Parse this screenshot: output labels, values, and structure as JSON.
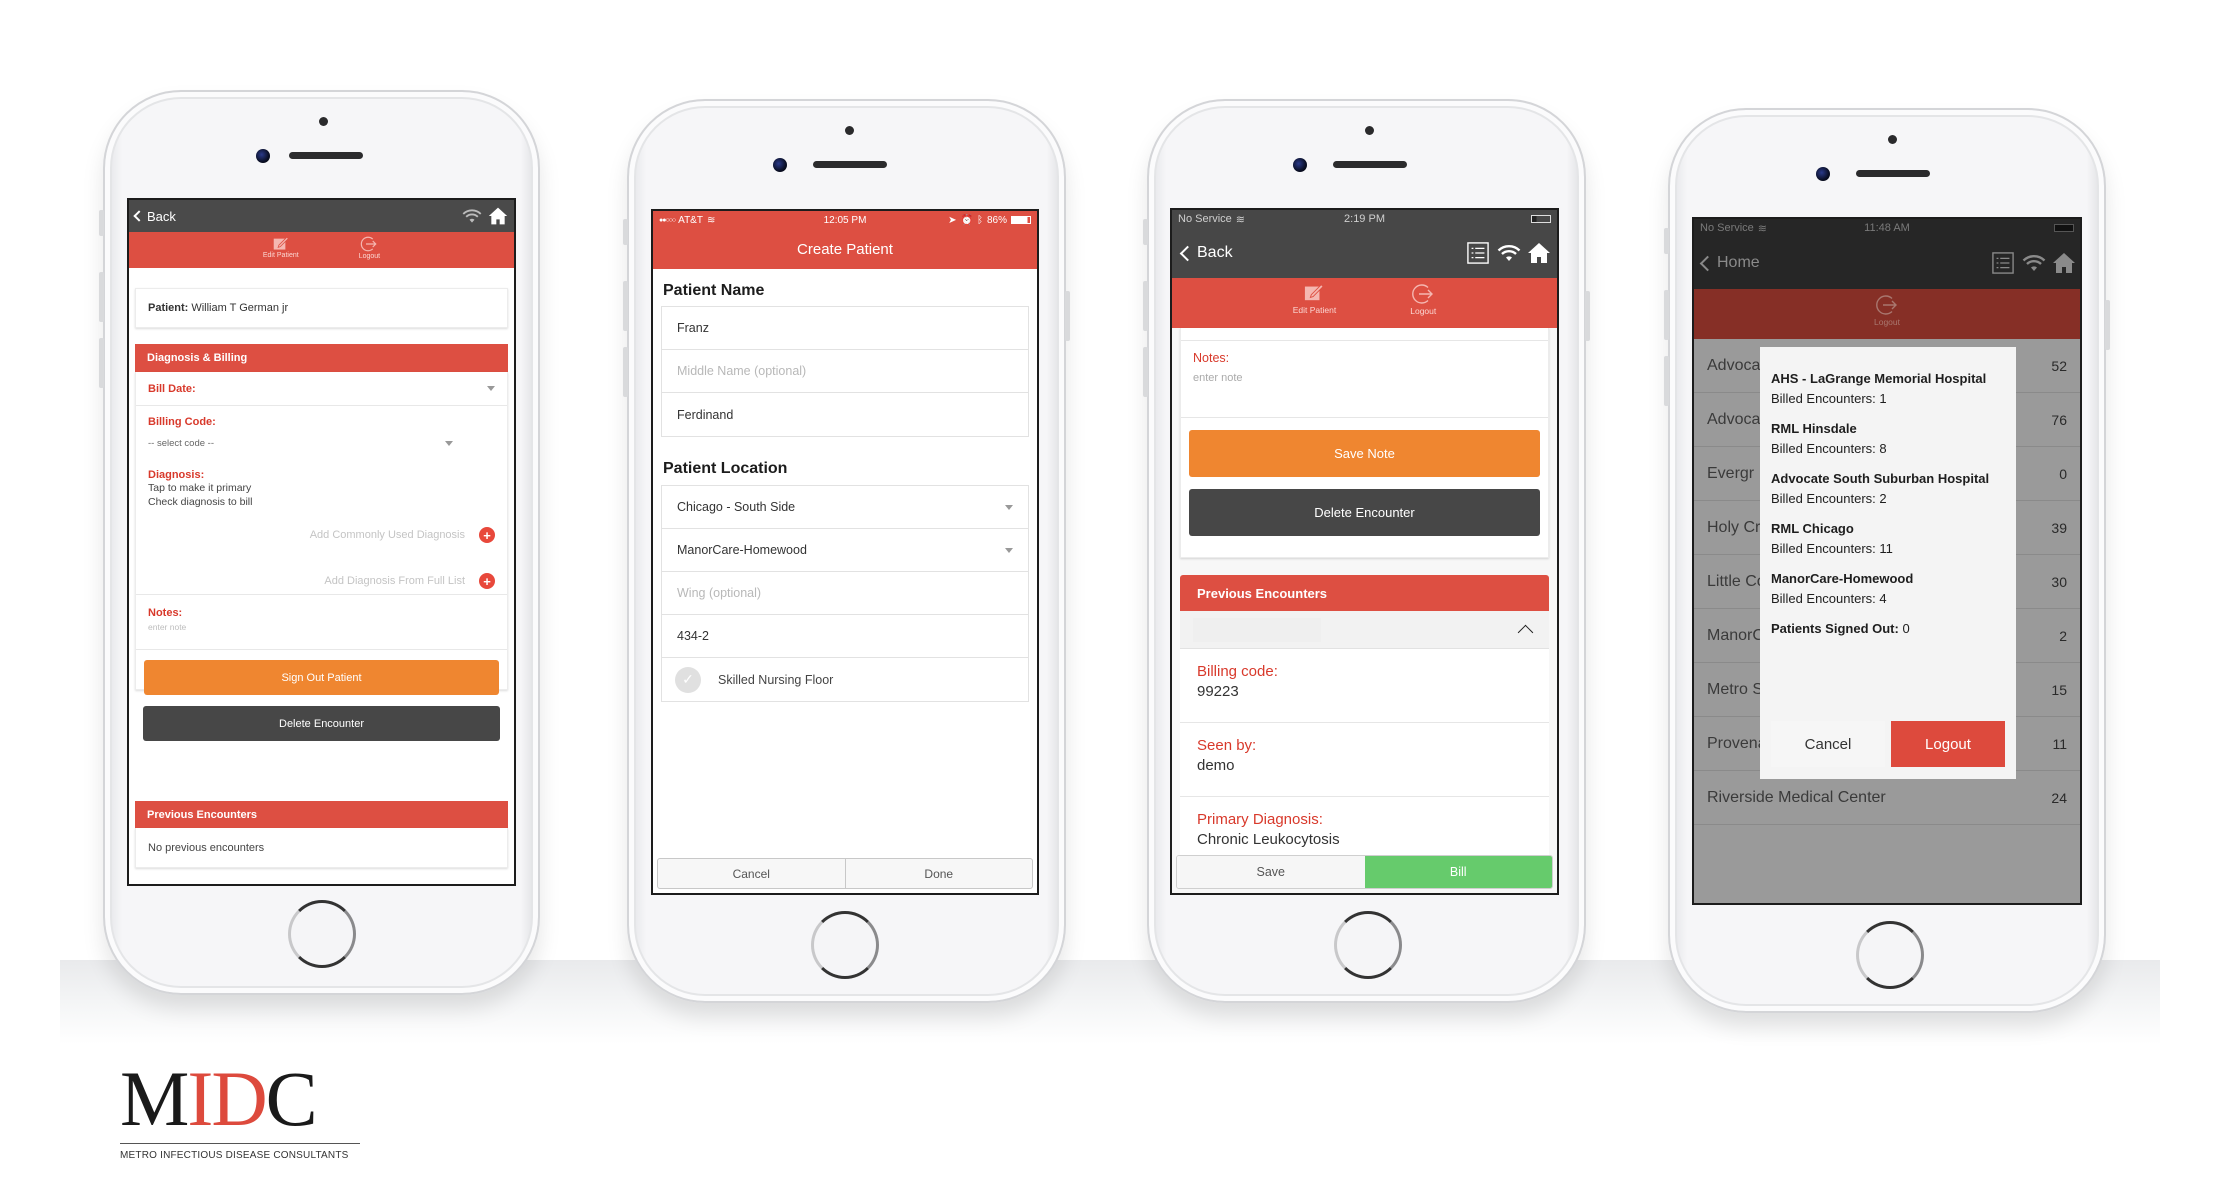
{
  "colors": {
    "brand_red": "#dd4f42",
    "orange": "#ef8630",
    "dark_gray": "#474747",
    "green": "#66cb6c"
  },
  "phone1": {
    "nav": {
      "back_label": "Back",
      "icons": [
        "wifi-icon",
        "home-icon"
      ]
    },
    "toolbar": {
      "edit_label": "Edit Patient",
      "logout_label": "Logout"
    },
    "patient": {
      "label": "Patient:",
      "name": "William T German jr"
    },
    "diagnosis_billing": {
      "header": "Diagnosis & Billing",
      "bill_date_label": "Bill Date:",
      "billing_code_label": "Billing Code:",
      "billing_code_value": "-- select code --",
      "diagnosis_label": "Diagnosis:",
      "diagnosis_hint1": "Tap to make it primary",
      "diagnosis_hint2": "Check diagnosis to bill",
      "add_common": "Add Commonly Used Diagnosis",
      "add_full": "Add Diagnosis From Full List",
      "notes_label": "Notes:",
      "notes_placeholder": "enter note",
      "sign_out": "Sign Out Patient",
      "delete": "Delete Encounter"
    },
    "previous": {
      "header": "Previous Encounters",
      "empty": "No previous encounters"
    }
  },
  "phone2": {
    "status": {
      "carrier": "AT&T",
      "time": "12:05 PM",
      "battery": "86%"
    },
    "title": "Create Patient",
    "name_section": "Patient Name",
    "first_name": "Franz",
    "middle_placeholder": "Middle Name (optional)",
    "last_name": "Ferdinand",
    "location_section": "Patient Location",
    "region": "Chicago - South Side",
    "facility": "ManorCare-Homewood",
    "wing_placeholder": "Wing (optional)",
    "room": "434-2",
    "skilled_nursing_label": "Skilled Nursing Floor",
    "cancel": "Cancel",
    "done": "Done"
  },
  "phone3": {
    "status": {
      "carrier": "No Service",
      "time": "2:19 PM"
    },
    "nav": {
      "back_label": "Back"
    },
    "toolbar": {
      "edit_label": "Edit Patient",
      "logout_label": "Logout"
    },
    "notes_label": "Notes:",
    "notes_placeholder": "enter note",
    "save_note": "Save Note",
    "delete": "Delete Encounter",
    "previous_header": "Previous Encounters",
    "encounter": {
      "billing_code_label": "Billing code:",
      "billing_code": "99223",
      "seen_by_label": "Seen by:",
      "seen_by": "demo",
      "primary_dx_label": "Primary Diagnosis:",
      "primary_dx": "Chronic Leukocytosis"
    },
    "save": "Save",
    "bill": "Bill"
  },
  "phone4": {
    "status": {
      "carrier": "No Service",
      "time": "11:48 AM"
    },
    "nav": {
      "back_label": "Home"
    },
    "toolbar": {
      "logout_label": "Logout"
    },
    "facilities": [
      {
        "name": "Advocate Christ Medical Center",
        "count": "52"
      },
      {
        "name": "Advocate South Suburban Hospital",
        "count": "76"
      },
      {
        "name": "Evergr",
        "count": "0"
      },
      {
        "name": "Holy Cross Hospital",
        "count": "39"
      },
      {
        "name": "Little Company of Mary Hospital",
        "count": "30"
      },
      {
        "name": "ManorCare-Homewood",
        "count": "2"
      },
      {
        "name": "Metro South Medical Center",
        "count": "15"
      },
      {
        "name": "Provena",
        "count": "11"
      },
      {
        "name": "Riverside Medical Center",
        "count": "24"
      }
    ],
    "modal": {
      "items": [
        {
          "name": "AHS - LaGrange Memorial Hospital",
          "billed": "Billed Encounters: 1"
        },
        {
          "name": "RML Hinsdale",
          "billed": "Billed Encounters: 8"
        },
        {
          "name": "Advocate South Suburban Hospital",
          "billed": "Billed Encounters: 2"
        },
        {
          "name": "RML Chicago",
          "billed": "Billed Encounters: 11"
        },
        {
          "name": "ManorCare-Homewood",
          "billed": "Billed Encounters: 4"
        }
      ],
      "signed_out_label": "Patients Signed Out:",
      "signed_out_value": " 0",
      "cancel": "Cancel",
      "logout": "Logout"
    }
  },
  "logo": {
    "m": "M",
    "id": "ID",
    "c": "C",
    "subtitle": "METRO INFECTIOUS DISEASE CONSULTANTS"
  }
}
